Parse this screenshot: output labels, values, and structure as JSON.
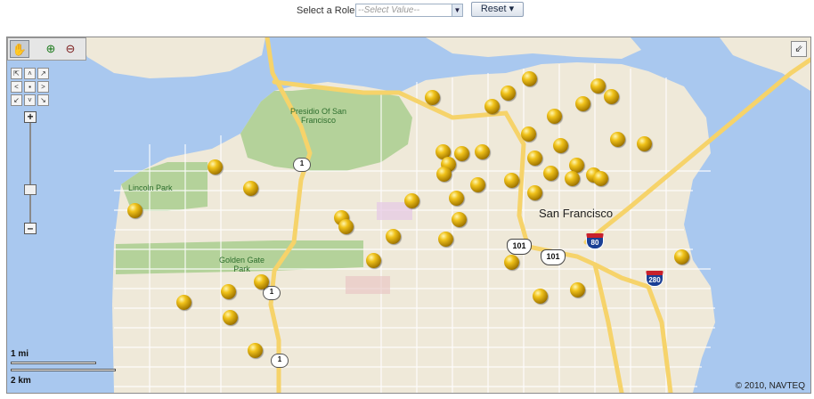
{
  "filter": {
    "role_label": "Select a Role",
    "role_placeholder": "--Select Value--",
    "reset_label": "Reset"
  },
  "map": {
    "city_label": "San Francisco",
    "place_labels": [
      "Presidio Of San\nFrancisco",
      "Lincoln Park",
      "Golden Gate\nPark"
    ],
    "shields": {
      "us101_a": "101",
      "us101_b": "101",
      "i80": "80",
      "i280": "280",
      "ca1_a": "1",
      "ca1_b": "1",
      "ca1_c": "1"
    },
    "scale": {
      "miles": "1 mi",
      "kilometers": "2 km"
    },
    "copyright": "© 2010, NAVTEQ",
    "colors": {
      "water": "#a9c8ef",
      "land": "#efe9d9",
      "park": "#b4d29a",
      "highway": "#f6d36a",
      "marker": "#d4a800"
    }
  },
  "toolbar": {
    "pan_icon": "hand-icon",
    "zoom_in_icon": "zoom-in-icon",
    "zoom_out_icon": "zoom-out-icon",
    "expand_icon": "expand-icon"
  }
}
